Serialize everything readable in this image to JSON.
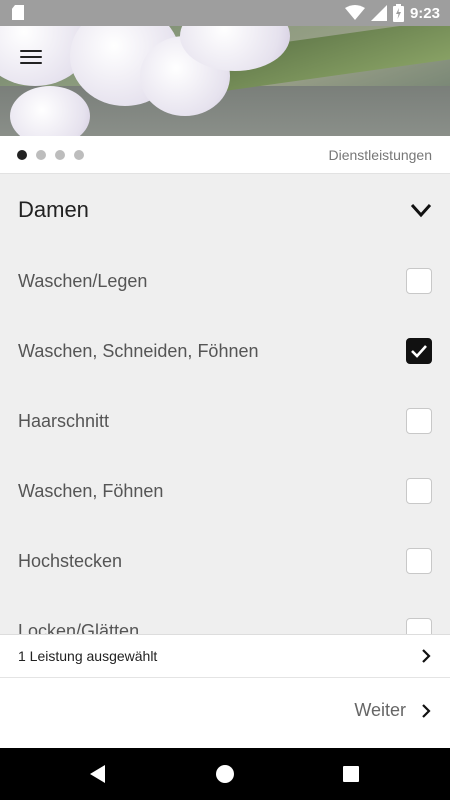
{
  "status_bar": {
    "time": "9:23",
    "icons": [
      "sd-card-icon",
      "wifi-icon",
      "signal-icon",
      "battery-charging-icon"
    ]
  },
  "header": {
    "menu_icon": "hamburger-menu-icon"
  },
  "pager": {
    "total": 4,
    "active_index": 0,
    "title": "Dienstleistungen"
  },
  "category": {
    "label": "Damen",
    "icon": "chevron-down-icon"
  },
  "services": [
    {
      "label": "Waschen/Legen",
      "checked": false
    },
    {
      "label": "Waschen, Schneiden, Föhnen",
      "checked": true
    },
    {
      "label": "Haarschnitt",
      "checked": false
    },
    {
      "label": "Waschen, Föhnen",
      "checked": false
    },
    {
      "label": "Hochstecken",
      "checked": false
    },
    {
      "label": "Locken/Glätten",
      "checked": false
    }
  ],
  "summary": {
    "label": "1 Leistung ausgewählt",
    "icon": "chevron-right-icon"
  },
  "footer": {
    "next_label": "Weiter",
    "icon": "chevron-right-icon"
  },
  "colors": {
    "accent": "#111111",
    "background": "#efefef",
    "status_bar": "#9e9e9e"
  }
}
